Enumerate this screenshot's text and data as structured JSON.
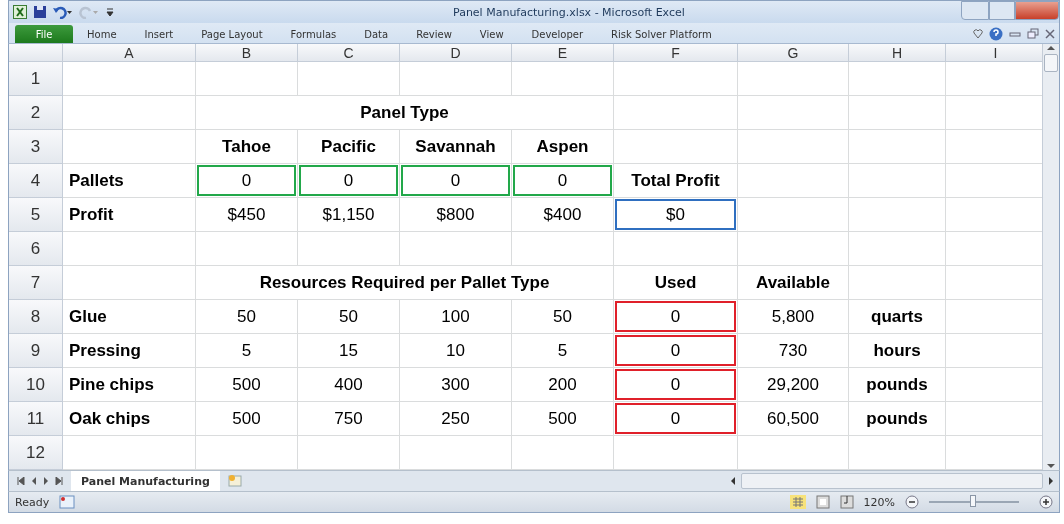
{
  "window": {
    "title": "Panel Manufacturing.xlsx  -  Microsoft Excel"
  },
  "ribbon": {
    "file_tab": "File",
    "tabs": [
      {
        "label": "Home",
        "selected": false
      },
      {
        "label": "Insert",
        "selected": false
      },
      {
        "label": "Page Layout",
        "selected": false
      },
      {
        "label": "Formulas",
        "selected": false
      },
      {
        "label": "Data",
        "selected": false
      },
      {
        "label": "Review",
        "selected": false
      },
      {
        "label": "View",
        "selected": false
      },
      {
        "label": "Developer",
        "selected": false
      },
      {
        "label": "Risk Solver Platform",
        "selected": false
      }
    ]
  },
  "sheet": {
    "columns": [
      "A",
      "B",
      "C",
      "D",
      "E",
      "F",
      "G",
      "H",
      "I"
    ],
    "rows": [
      {
        "header": "1",
        "cells": []
      },
      {
        "header": "2",
        "cells": [
          "",
          {
            "text": "Panel Type",
            "bold": true,
            "kind": "merged"
          },
          "",
          "",
          ""
        ]
      },
      {
        "header": "3",
        "cells": [
          "",
          {
            "text": "Tahoe",
            "bold": true
          },
          {
            "text": "Pacific",
            "bold": true
          },
          {
            "text": "Savannah",
            "bold": true
          },
          {
            "text": "Aspen",
            "bold": true
          }
        ]
      },
      {
        "header": "4",
        "cells": [
          {
            "text": "Pallets",
            "bold": true
          },
          {
            "text": "0",
            "color": "#22a84a"
          },
          {
            "text": "0",
            "color": "#22a84a"
          },
          {
            "text": "0",
            "color": "#22a84a"
          },
          {
            "text": "0",
            "color": "#22a84a"
          },
          {
            "text": "Total Profit",
            "bold": true
          }
        ]
      },
      {
        "header": "5",
        "cells": [
          {
            "text": "Profit",
            "bold": true
          },
          {
            "text": "$450"
          },
          {
            "text": "$1,150"
          },
          {
            "text": "$800"
          },
          {
            "text": "$400"
          },
          {
            "text": "$0",
            "color": "#2f6fc0"
          }
        ]
      },
      {
        "header": "6",
        "cells": []
      },
      {
        "header": "7",
        "cells": [
          "",
          {
            "text": "Resources Required per Pallet Type",
            "bold": true,
            "kind": "merged"
          },
          "",
          "",
          "",
          {
            "text": "Used",
            "bold": true
          },
          {
            "text": "Available",
            "bold": true
          }
        ]
      },
      {
        "header": "8",
        "cells": [
          {
            "text": "Glue",
            "bold": true
          },
          {
            "text": "50"
          },
          {
            "text": "50"
          },
          {
            "text": "100"
          },
          {
            "text": "50"
          },
          {
            "text": "0",
            "color": "#e0202a"
          },
          {
            "text": "5,800"
          },
          {
            "text": "quarts",
            "bold": true
          }
        ]
      },
      {
        "header": "9",
        "cells": [
          {
            "text": "Pressing",
            "bold": true
          },
          {
            "text": "5"
          },
          {
            "text": "15"
          },
          {
            "text": "10"
          },
          {
            "text": "5"
          },
          {
            "text": "0",
            "color": "#e0202a"
          },
          {
            "text": "730"
          },
          {
            "text": "hours",
            "bold": true
          }
        ]
      },
      {
        "header": "10",
        "cells": [
          {
            "text": "Pine chips",
            "bold": true
          },
          {
            "text": "500"
          },
          {
            "text": "400"
          },
          {
            "text": "300"
          },
          {
            "text": "200"
          },
          {
            "text": "0",
            "color": "#e0202a"
          },
          {
            "text": "29,200"
          },
          {
            "text": "pounds",
            "bold": true
          }
        ]
      },
      {
        "header": "11",
        "cells": [
          {
            "text": "Oak chips",
            "bold": true
          },
          {
            "text": "500"
          },
          {
            "text": "750"
          },
          {
            "text": "250"
          },
          {
            "text": "500"
          },
          {
            "text": "0",
            "color": "#e0202a"
          },
          {
            "text": "60,500"
          },
          {
            "text": "pounds",
            "bold": true
          }
        ]
      },
      {
        "header": "12",
        "cells": []
      }
    ]
  },
  "sheet_tabs": [
    {
      "label": "Panel Manufacturing",
      "selected": true
    }
  ],
  "status_bar": {
    "status": "Ready",
    "zoom": "120%",
    "zoom_slider": {
      "level": 0.5
    }
  }
}
